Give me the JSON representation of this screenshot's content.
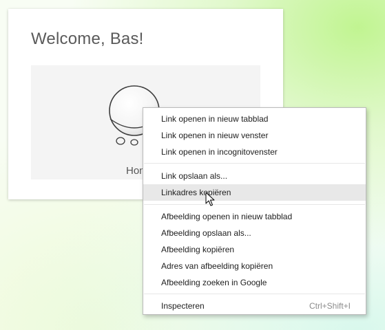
{
  "card": {
    "title": "Welcome, Bas!",
    "device_label": "Hon"
  },
  "context_menu": {
    "groups": [
      [
        {
          "label": "Link openen in nieuw tabblad"
        },
        {
          "label": "Link openen in nieuw venster"
        },
        {
          "label": "Link openen in incognitovenster"
        }
      ],
      [
        {
          "label": "Link opslaan als..."
        },
        {
          "label": "Linkadres kopiëren",
          "highlighted": true
        }
      ],
      [
        {
          "label": "Afbeelding openen in nieuw tabblad"
        },
        {
          "label": "Afbeelding opslaan als..."
        },
        {
          "label": "Afbeelding kopiëren"
        },
        {
          "label": "Adres van afbeelding kopiëren"
        },
        {
          "label": "Afbeelding zoeken in Google"
        }
      ],
      [
        {
          "label": "Inspecteren",
          "shortcut": "Ctrl+Shift+I"
        }
      ]
    ]
  },
  "colors": {
    "menu_highlight": "#e8e8e8",
    "shortcut_text": "#8a8a8a",
    "title_text": "#5a5a5a"
  },
  "icons": {
    "cursor": "arrow-pointer",
    "device": "homey-device"
  }
}
